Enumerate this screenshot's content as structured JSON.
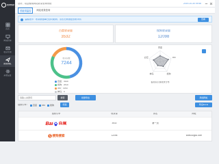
{
  "sidebar": {
    "logo_text": "搜狗快排",
    "active_index": 3,
    "items": [
      {
        "label": "首页",
        "icon": "dashboard-icon"
      },
      {
        "label": "网站管理",
        "icon": "monitor-icon"
      },
      {
        "label": "收录查询",
        "icon": "mail-icon"
      },
      {
        "label": "搜索排名",
        "icon": "rocket-icon"
      },
      {
        "label": "系统设置",
        "icon": "gear-icon"
      }
    ]
  },
  "header": {
    "welcome": "您好，欢迎使用网站收录查询系统",
    "datetime": "2019-10-30 09:46",
    "icons": [
      "minimize-icon",
      "close-icon"
    ]
  },
  "tabs": [
    {
      "label": "关键词监控",
      "active": true
    },
    {
      "label": "网站收录查询",
      "active": false
    }
  ],
  "banner": {
    "icon": "info-icon",
    "text": "温馨提示：收录数据每日自动更新，点击右侧按钮查看详情",
    "button": "查看"
  },
  "stats": [
    {
      "label": "百度收录量",
      "value": "3532",
      "color": "#f0863f"
    },
    {
      "label": "搜狗收录量",
      "value": "12098",
      "color": "#5b8fd0"
    }
  ],
  "overview": {
    "total_label": "收录总数",
    "total_value": "7244",
    "legend": [
      {
        "label": "百度：3340",
        "color": "#4a90e2"
      },
      {
        "label": "搜狗：2610",
        "color": "#4cc18a"
      },
      {
        "label": "360：1294",
        "color": "#f39a4a"
      },
      {
        "label": "神马：0",
        "color": "#c8ccd2"
      }
    ],
    "radar_caption": "各搜索引擎收录分布",
    "expand_icon": "expand-icon"
  },
  "chart_data": [
    {
      "type": "pie",
      "variant": "donut",
      "total": 7244,
      "segments": [
        {
          "name": "百度",
          "value": 3340,
          "color": "#4a90e2"
        },
        {
          "name": "搜狗",
          "value": 2610,
          "color": "#4cc18a"
        },
        {
          "name": "360",
          "value": 1294,
          "color": "#f39a4a"
        },
        {
          "name": "神马",
          "value": 0,
          "color": "#c8ccd2"
        }
      ]
    },
    {
      "type": "radar",
      "axes": [
        "百度",
        "360",
        "搜狗",
        "神马",
        "必应"
      ],
      "max": 1,
      "rings": 3,
      "values": [
        0.55,
        0.75,
        0.45,
        0.35,
        0.6
      ]
    }
  ],
  "toolbar": {
    "search_placeholder": "请输入关键词",
    "search_button": "搜索",
    "export_button": "批量导出",
    "add_button": "添加网址"
  },
  "filter": {
    "label": "搜索引擎：",
    "options": [
      {
        "label": "百度",
        "checked": true
      },
      {
        "label": "360",
        "checked": true
      },
      {
        "label": "搜狗",
        "checked": true
      }
    ],
    "apply_button": "筛选",
    "export_button": "导出Excel"
  },
  "table": {
    "headers": [
      "搜索引擎",
      "收录量",
      "排名",
      "网址"
    ],
    "rows": [
      {
        "logo_a": "Bai",
        "logo_b": "百度",
        "logo_icon": "baidu-paw-icon",
        "count": "3532",
        "rank": "第一页",
        "url": ""
      },
      {
        "logo_text": "搜狗搜索",
        "logo_icon": "sogou-icon",
        "count": "12098",
        "rank": "",
        "url": "www.sogou.com"
      }
    ]
  }
}
